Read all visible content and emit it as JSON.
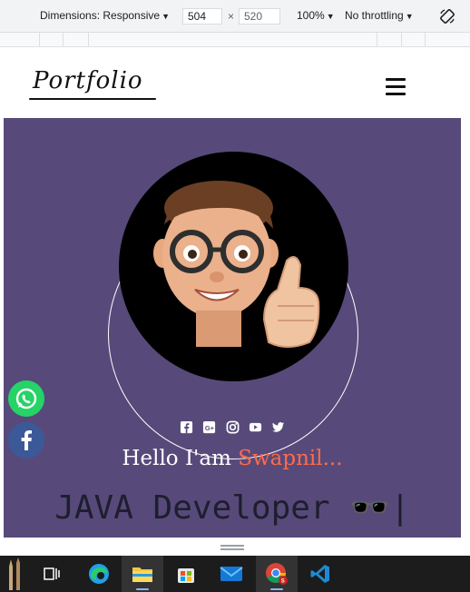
{
  "devtools": {
    "dimensions_label": "Dimensions: Responsive",
    "width": "504",
    "times": "×",
    "height": "520",
    "zoom": "100%",
    "throttling": "No throttling"
  },
  "site": {
    "logo": "Portfolio",
    "greeting_prefix": "Hello I'am",
    "greeting_name": "Swapnil...",
    "role_text": "JAVA Developer 🕶️|",
    "social_icons": [
      "facebook-icon",
      "google-plus-icon",
      "instagram-icon",
      "youtube-icon",
      "twitter-icon"
    ]
  },
  "floating": {
    "whatsapp": "whatsapp-icon",
    "facebook": "facebook-icon"
  },
  "taskbar": {
    "apps": [
      "task-view",
      "edge",
      "file-explorer",
      "microsoft-store",
      "mail",
      "chrome",
      "vscode"
    ]
  },
  "colors": {
    "hero_bg": "#574a7a",
    "accent_name": "#ff6b4a",
    "role_text": "#1e1e2e",
    "whatsapp": "#25d366",
    "facebook": "#3b5998"
  }
}
